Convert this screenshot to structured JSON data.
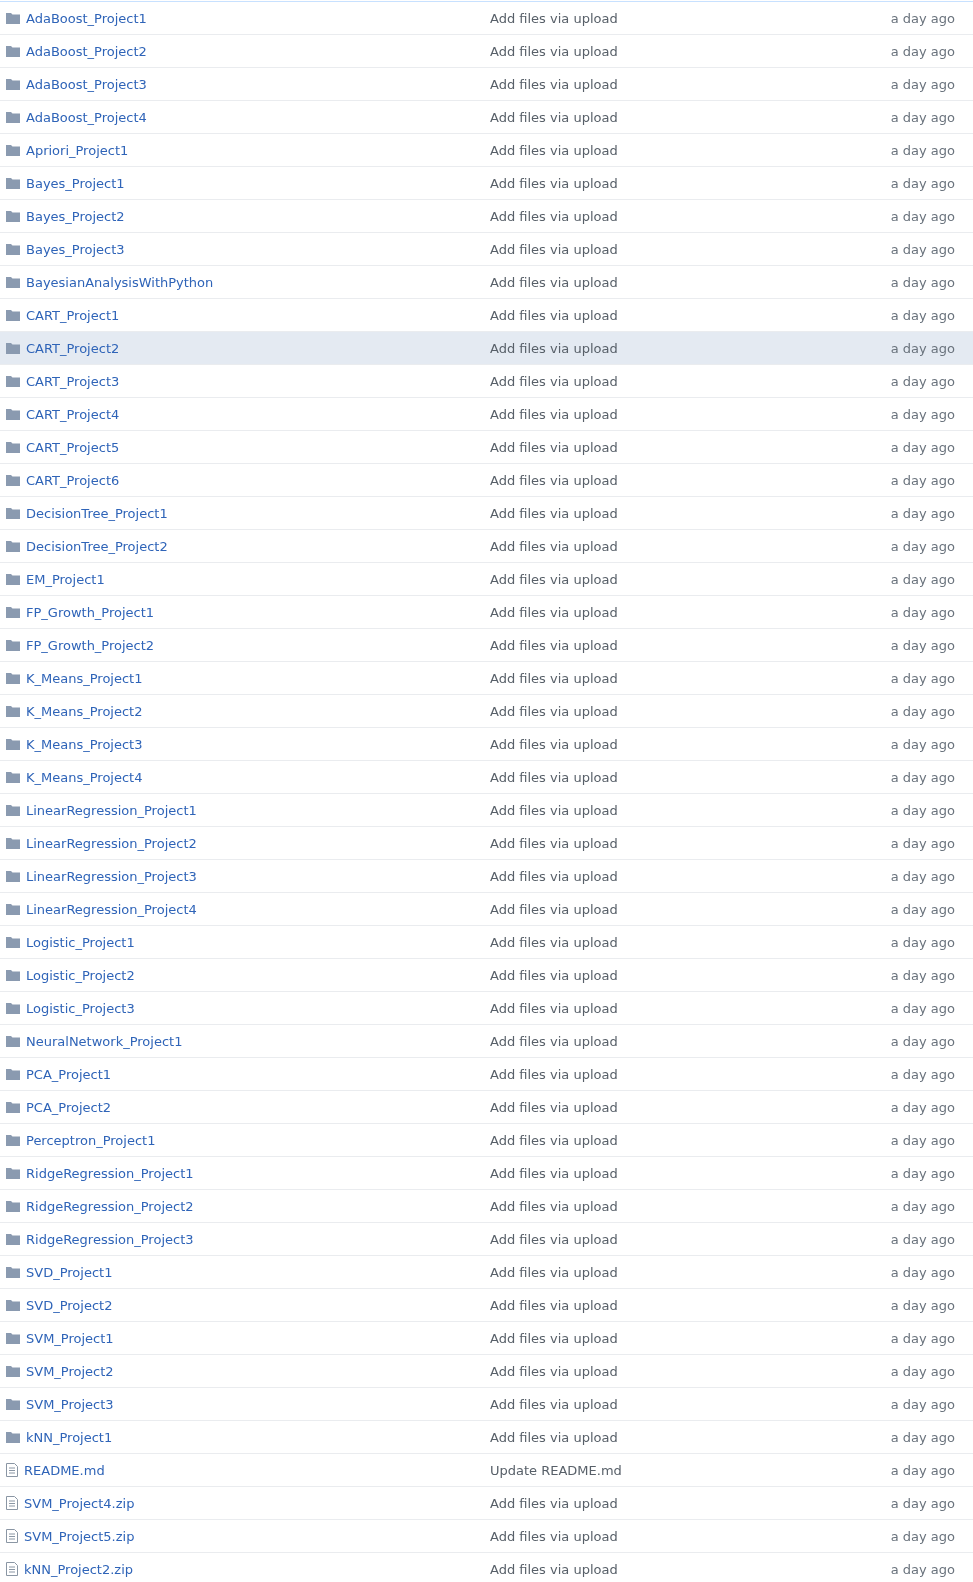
{
  "files": [
    {
      "kind": "folder",
      "name": "AdaBoost_Project1",
      "message": "Add files via upload",
      "age": "a day ago",
      "selected": false
    },
    {
      "kind": "folder",
      "name": "AdaBoost_Project2",
      "message": "Add files via upload",
      "age": "a day ago",
      "selected": false
    },
    {
      "kind": "folder",
      "name": "AdaBoost_Project3",
      "message": "Add files via upload",
      "age": "a day ago",
      "selected": false
    },
    {
      "kind": "folder",
      "name": "AdaBoost_Project4",
      "message": "Add files via upload",
      "age": "a day ago",
      "selected": false
    },
    {
      "kind": "folder",
      "name": "Apriori_Project1",
      "message": "Add files via upload",
      "age": "a day ago",
      "selected": false
    },
    {
      "kind": "folder",
      "name": "Bayes_Project1",
      "message": "Add files via upload",
      "age": "a day ago",
      "selected": false
    },
    {
      "kind": "folder",
      "name": "Bayes_Project2",
      "message": "Add files via upload",
      "age": "a day ago",
      "selected": false
    },
    {
      "kind": "folder",
      "name": "Bayes_Project3",
      "message": "Add files via upload",
      "age": "a day ago",
      "selected": false
    },
    {
      "kind": "folder",
      "name": "BayesianAnalysisWithPython",
      "message": "Add files via upload",
      "age": "a day ago",
      "selected": false
    },
    {
      "kind": "folder",
      "name": "CART_Project1",
      "message": "Add files via upload",
      "age": "a day ago",
      "selected": false
    },
    {
      "kind": "folder",
      "name": "CART_Project2",
      "message": "Add files via upload",
      "age": "a day ago",
      "selected": true
    },
    {
      "kind": "folder",
      "name": "CART_Project3",
      "message": "Add files via upload",
      "age": "a day ago",
      "selected": false
    },
    {
      "kind": "folder",
      "name": "CART_Project4",
      "message": "Add files via upload",
      "age": "a day ago",
      "selected": false
    },
    {
      "kind": "folder",
      "name": "CART_Project5",
      "message": "Add files via upload",
      "age": "a day ago",
      "selected": false
    },
    {
      "kind": "folder",
      "name": "CART_Project6",
      "message": "Add files via upload",
      "age": "a day ago",
      "selected": false
    },
    {
      "kind": "folder",
      "name": "DecisionTree_Project1",
      "message": "Add files via upload",
      "age": "a day ago",
      "selected": false
    },
    {
      "kind": "folder",
      "name": "DecisionTree_Project2",
      "message": "Add files via upload",
      "age": "a day ago",
      "selected": false
    },
    {
      "kind": "folder",
      "name": "EM_Project1",
      "message": "Add files via upload",
      "age": "a day ago",
      "selected": false
    },
    {
      "kind": "folder",
      "name": "FP_Growth_Project1",
      "message": "Add files via upload",
      "age": "a day ago",
      "selected": false
    },
    {
      "kind": "folder",
      "name": "FP_Growth_Project2",
      "message": "Add files via upload",
      "age": "a day ago",
      "selected": false
    },
    {
      "kind": "folder",
      "name": "K_Means_Project1",
      "message": "Add files via upload",
      "age": "a day ago",
      "selected": false
    },
    {
      "kind": "folder",
      "name": "K_Means_Project2",
      "message": "Add files via upload",
      "age": "a day ago",
      "selected": false
    },
    {
      "kind": "folder",
      "name": "K_Means_Project3",
      "message": "Add files via upload",
      "age": "a day ago",
      "selected": false
    },
    {
      "kind": "folder",
      "name": "K_Means_Project4",
      "message": "Add files via upload",
      "age": "a day ago",
      "selected": false
    },
    {
      "kind": "folder",
      "name": "LinearRegression_Project1",
      "message": "Add files via upload",
      "age": "a day ago",
      "selected": false
    },
    {
      "kind": "folder",
      "name": "LinearRegression_Project2",
      "message": "Add files via upload",
      "age": "a day ago",
      "selected": false
    },
    {
      "kind": "folder",
      "name": "LinearRegression_Project3",
      "message": "Add files via upload",
      "age": "a day ago",
      "selected": false
    },
    {
      "kind": "folder",
      "name": "LinearRegression_Project4",
      "message": "Add files via upload",
      "age": "a day ago",
      "selected": false
    },
    {
      "kind": "folder",
      "name": "Logistic_Project1",
      "message": "Add files via upload",
      "age": "a day ago",
      "selected": false
    },
    {
      "kind": "folder",
      "name": "Logistic_Project2",
      "message": "Add files via upload",
      "age": "a day ago",
      "selected": false
    },
    {
      "kind": "folder",
      "name": "Logistic_Project3",
      "message": "Add files via upload",
      "age": "a day ago",
      "selected": false
    },
    {
      "kind": "folder",
      "name": "NeuralNetwork_Project1",
      "message": "Add files via upload",
      "age": "a day ago",
      "selected": false
    },
    {
      "kind": "folder",
      "name": "PCA_Project1",
      "message": "Add files via upload",
      "age": "a day ago",
      "selected": false
    },
    {
      "kind": "folder",
      "name": "PCA_Project2",
      "message": "Add files via upload",
      "age": "a day ago",
      "selected": false
    },
    {
      "kind": "folder",
      "name": "Perceptron_Project1",
      "message": "Add files via upload",
      "age": "a day ago",
      "selected": false
    },
    {
      "kind": "folder",
      "name": "RidgeRegression_Project1",
      "message": "Add files via upload",
      "age": "a day ago",
      "selected": false
    },
    {
      "kind": "folder",
      "name": "RidgeRegression_Project2",
      "message": "Add files via upload",
      "age": "a day ago",
      "selected": false
    },
    {
      "kind": "folder",
      "name": "RidgeRegression_Project3",
      "message": "Add files via upload",
      "age": "a day ago",
      "selected": false
    },
    {
      "kind": "folder",
      "name": "SVD_Project1",
      "message": "Add files via upload",
      "age": "a day ago",
      "selected": false
    },
    {
      "kind": "folder",
      "name": "SVD_Project2",
      "message": "Add files via upload",
      "age": "a day ago",
      "selected": false
    },
    {
      "kind": "folder",
      "name": "SVM_Project1",
      "message": "Add files via upload",
      "age": "a day ago",
      "selected": false
    },
    {
      "kind": "folder",
      "name": "SVM_Project2",
      "message": "Add files via upload",
      "age": "a day ago",
      "selected": false
    },
    {
      "kind": "folder",
      "name": "SVM_Project3",
      "message": "Add files via upload",
      "age": "a day ago",
      "selected": false
    },
    {
      "kind": "folder",
      "name": "kNN_Project1",
      "message": "Add files via upload",
      "age": "a day ago",
      "selected": false
    },
    {
      "kind": "file",
      "name": "README.md",
      "message": "Update README.md",
      "age": "a day ago",
      "selected": false
    },
    {
      "kind": "file",
      "name": "SVM_Project4.zip",
      "message": "Add files via upload",
      "age": "a day ago",
      "selected": false
    },
    {
      "kind": "file",
      "name": "SVM_Project5.zip",
      "message": "Add files via upload",
      "age": "a day ago",
      "selected": false
    },
    {
      "kind": "file",
      "name": "kNN_Project2.zip",
      "message": "Add files via upload",
      "age": "a day ago",
      "selected": false
    }
  ]
}
